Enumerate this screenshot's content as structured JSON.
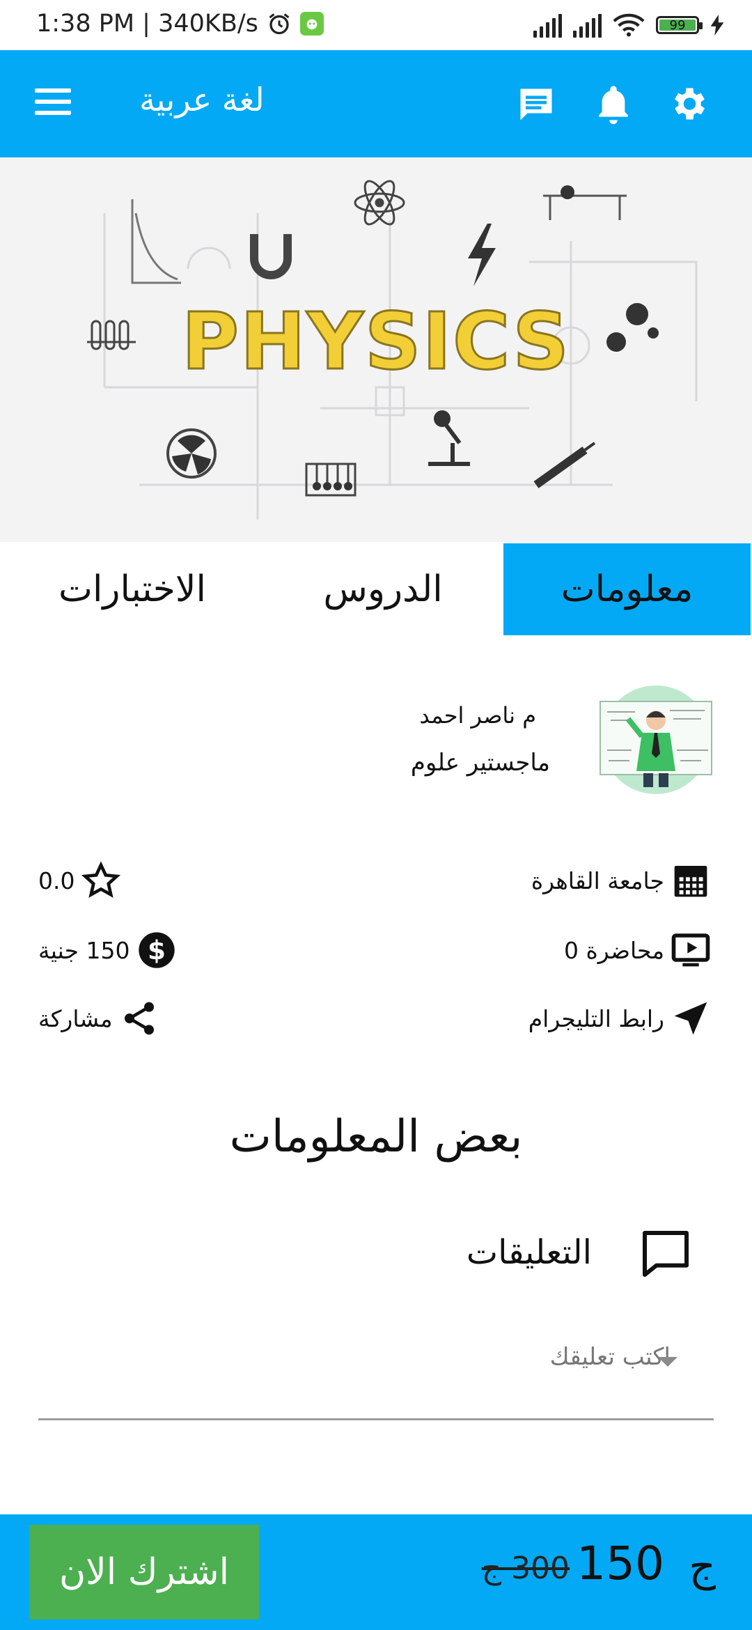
{
  "status_bar": {
    "time_speed": "1:38 PM | 340KB/s",
    "battery_level": "99"
  },
  "toolbar": {
    "title": "لغة عربية",
    "color": "#03a9f4"
  },
  "banner": {
    "word": "PHYSICS"
  },
  "tabs": [
    {
      "label": "معلومات",
      "active": true
    },
    {
      "label": "الدروس",
      "active": false
    },
    {
      "label": "الاختبارات",
      "active": false
    }
  ],
  "instructor": {
    "name": "م ناصر احمد",
    "degree": "ماجستير علوم"
  },
  "info": {
    "university": "جامعة القاهرة",
    "rating": "0.0",
    "lectures": "محاضرة 0",
    "price": "150 جنية",
    "telegram": "رابط التليجرام",
    "share": "مشاركة"
  },
  "section_title": "بعض المعلومات",
  "comments": {
    "label": "التعليقات",
    "placeholder": "اكتب تعليقك"
  },
  "bottom_bar": {
    "subscribe_label": "اشترك الان",
    "currency": "ج",
    "new_price": "150",
    "old_price": "300 ج",
    "button_color": "#4caf50"
  }
}
